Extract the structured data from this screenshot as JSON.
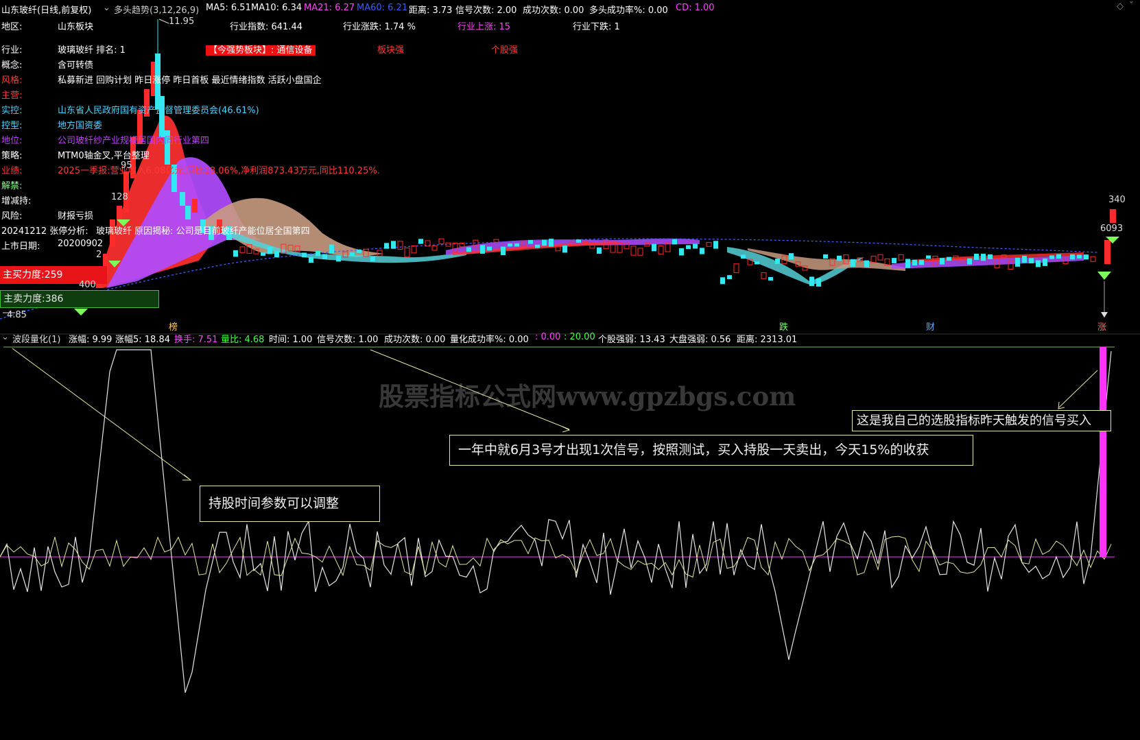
{
  "top_header": {
    "stock_title": "山东玻纤(日线,前复权)",
    "indicator_name": "多头趋势(3,12,26,9)",
    "ma5": "MA5: 6.51",
    "ma10": "MA10: 6.34",
    "ma21": "MA21: 6.27",
    "ma60": "MA60: 6.21",
    "distance": "距离: 3.73",
    "signal_count": "信号次数: 2.00",
    "success_count": "成功次数: 0.00",
    "bull_success_rate": "多头成功率%: 0.00",
    "cd": "CD: 1.00"
  },
  "info_panel": {
    "rows": [
      {
        "label": "地区:",
        "value": "山东板块"
      },
      {
        "label": "行业:",
        "value": "玻璃玻纤 排名: 1"
      },
      {
        "label": "概念:",
        "value": "含可转债"
      },
      {
        "label": "风格:",
        "value": "私募新进 回购计划 昨日涨停 昨日首板 最近情绪指数 活跃小盘国企"
      },
      {
        "label": "主营:",
        "value": ""
      },
      {
        "label": "实控:",
        "value": "山东省人民政府国有资产监督管理委员会(46.61%)"
      },
      {
        "label": "控型:",
        "value": "地方国资委"
      },
      {
        "label": "地位:",
        "value": "公司玻纤纱产业规模居国内同行业第四"
      },
      {
        "label": "策略:",
        "value": "MTM0轴金叉,平台整理"
      },
      {
        "label": "业绩:",
        "value": "2025一季报:营业收入6.08亿元,同比18.06%,净利润873.43万元,同比110.25%."
      },
      {
        "label": "解禁:",
        "value": ""
      },
      {
        "label": "增减持:",
        "value": ""
      },
      {
        "label": "风险:",
        "value": "财报亏损"
      },
      {
        "label": "20241212 张停分析:",
        "value": "玻璃玻纤 原因揭秘: 公司是目前玻纤产能位居全国第四"
      },
      {
        "label": "上市日期:",
        "value": "20200902"
      }
    ],
    "industry_index": "行业指数: 641.44",
    "industry_change": "行业涨跌: 1.74 %",
    "industry_up": "行业上涨: 15",
    "industry_down": "行业下跌: 1",
    "strong_sector_tag": "【今强势板块】: 通信设备",
    "sector_strong": "板块强",
    "stock_strong": "个股强",
    "main_buy_force": "主买力度:259",
    "main_sell_force": "主卖力度:386"
  },
  "price_labels": {
    "high": "11.95",
    "low": "4.85",
    "p95": "95",
    "p128": "128",
    "p2": "2",
    "p400": "400",
    "r340": "340",
    "r6093": "6093"
  },
  "bottom_markers": {
    "m1": "榜",
    "m2": "跌",
    "m3": "财",
    "m4": "涨"
  },
  "sub_header": {
    "name": "波段量化(1)",
    "zhangfu": "涨幅: 9.99",
    "zhangfu5": "涨幅5: 18.84",
    "turnover": "换手: 7.51",
    "volume_ratio": "量比: 4.68",
    "time": "时间: 1.00",
    "signal_count": "信号次数: 1.00",
    "success_count": "成功次数: 0.00",
    "quant_success_rate": "量化成功率%: 0.00",
    "v1": ": 0.00",
    "v2": ": 20.00",
    "stock_strength": "个股强弱: 13.43",
    "market_strength": "大盘强弱: 0.56",
    "distance": "距离: 2313.01"
  },
  "annotations": {
    "hold_time": "持股时间参数可以调整",
    "one_signal": "一年中就6月3号才出现1次信号，按照测试，买入持股一天卖出，今天15%的收获",
    "my_signal": "这是我自己的选股指标昨天触发的信号买入"
  },
  "watermark": "股票指标公式网www.gpzbgs.com",
  "colors": {
    "up_red": "#ff2a2a",
    "down_cyan": "#33e8f0",
    "purple_band": "#b04cff",
    "tan_band": "#c89a80",
    "cyan_band": "#55d0d8",
    "magenta": "#ff33ff",
    "yellow_text": "#ffff66",
    "blue_ma": "#3a5cff"
  }
}
